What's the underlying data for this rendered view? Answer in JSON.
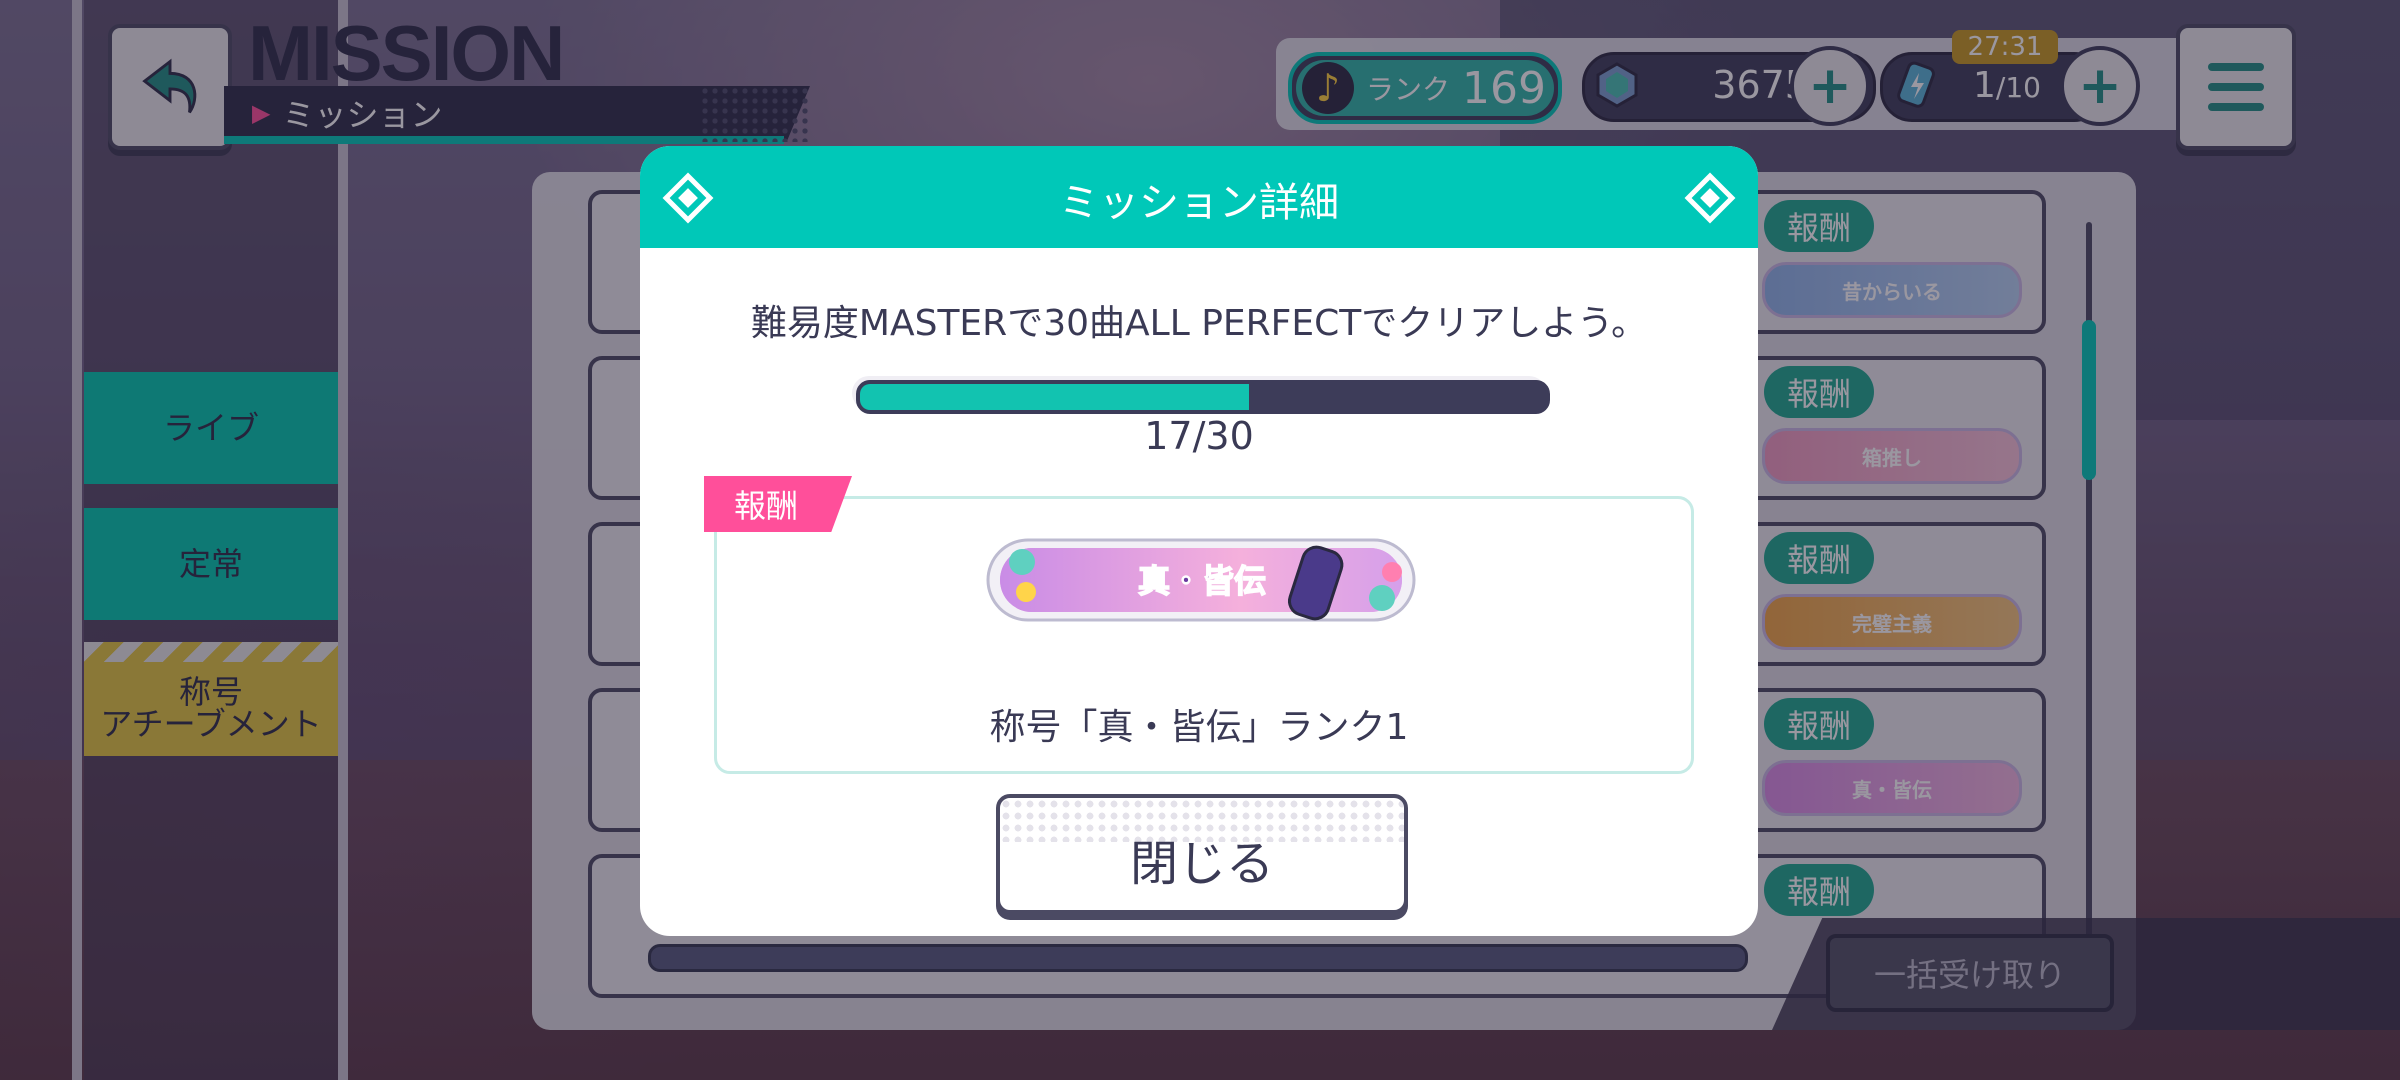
{
  "header": {
    "title": "MISSION",
    "subtitle": "ミッション"
  },
  "status": {
    "rank_label": "ランク",
    "rank_value": "169",
    "gems": "3675",
    "energy_current": "1",
    "energy_max": "/10",
    "timer": "27:31",
    "plus": "+"
  },
  "tabs": {
    "live": "ライブ",
    "normal": "定常",
    "title_line1": "称号",
    "title_line2": "アチーブメント"
  },
  "list": {
    "reward_label": "報酬",
    "rewards": [
      {
        "title": "昔からいる",
        "colors": [
          "#8fb4ea",
          "#b6d1f3"
        ]
      },
      {
        "title": "箱推し",
        "colors": [
          "#f19ac0",
          "#f7c2d9"
        ]
      },
      {
        "title": "完璧主義",
        "colors": [
          "#f0a545",
          "#f5c57c"
        ]
      },
      {
        "title": "真・皆伝",
        "colors": [
          "#d98be6",
          "#f2b6e0"
        ]
      }
    ],
    "bulk_button": "一括受け取り"
  },
  "modal": {
    "title": "ミッション詳細",
    "description": "難易度MASTERで30曲ALL PERFECTでクリアしよう。",
    "progress_current": 17,
    "progress_total": 30,
    "progress_text": "17/30",
    "reward_tag": "報酬",
    "reward_title_text": "真・皆伝",
    "reward_name": "称号「真・皆伝」ランク1",
    "close_button": "閉じる"
  },
  "colors": {
    "accent_teal": "#00c8b8",
    "reward_pink": "#ff4f9a",
    "dark_navy": "#3d3c59"
  }
}
